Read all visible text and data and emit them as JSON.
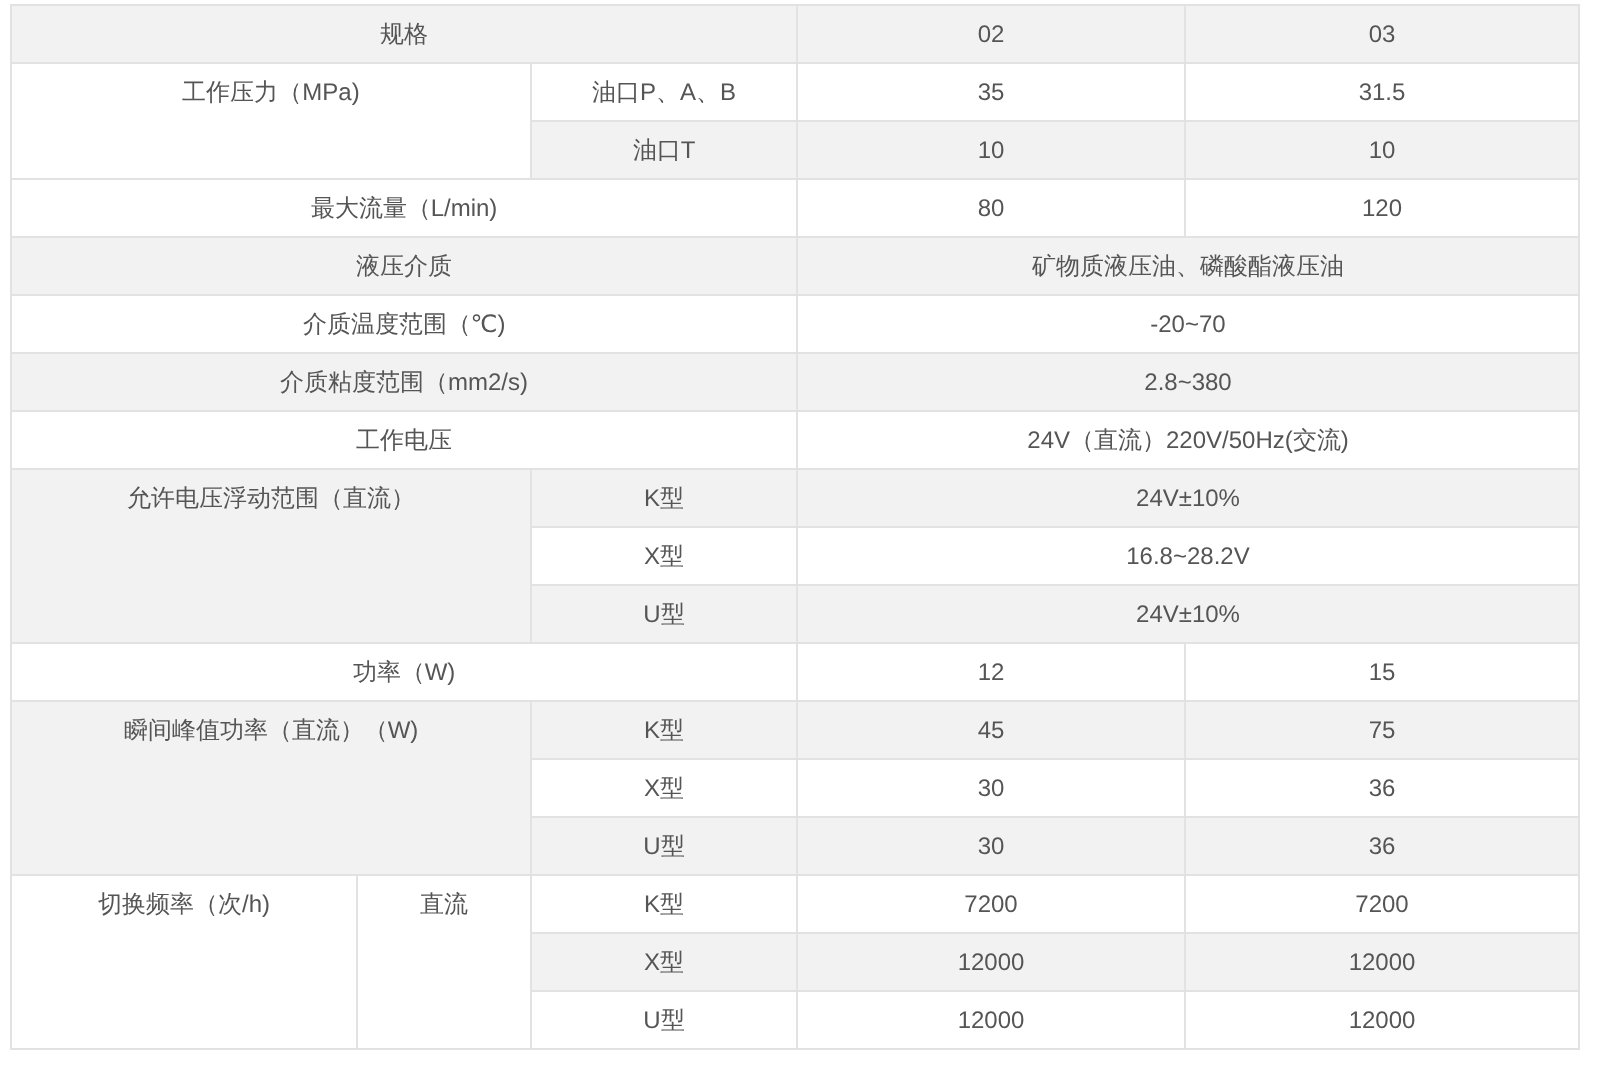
{
  "table": {
    "groups": [
      {
        "label": "规格",
        "values": [
          "02",
          "03"
        ]
      },
      {
        "label": "工作压力（MPa)",
        "subrows": [
          {
            "label": "油口P、A、B",
            "values": [
              "35",
              "31.5"
            ]
          },
          {
            "label": "油口T",
            "values": [
              "10",
              "10"
            ]
          }
        ]
      },
      {
        "label": "最大流量（L/min)",
        "values": [
          "80",
          "120"
        ]
      },
      {
        "label": "液压介质",
        "value": "矿物质液压油、磷酸酯液压油"
      },
      {
        "label": "介质温度范围（℃)",
        "value": "-20~70"
      },
      {
        "label": "介质粘度范围（mm2/s)",
        "value": "2.8~380"
      },
      {
        "label": "工作电压",
        "value": "24V（直流）220V/50Hz(交流)"
      },
      {
        "label": "允许电压浮动范围（直流）",
        "subrows": [
          {
            "label": "K型",
            "value": "24V±10%"
          },
          {
            "label": "X型",
            "value": "16.8~28.2V"
          },
          {
            "label": "U型",
            "value": "24V±10%"
          }
        ]
      },
      {
        "label": "功率（W)",
        "values": [
          "12",
          "15"
        ]
      },
      {
        "label": "瞬间峰值功率（直流）（W)",
        "subrows": [
          {
            "label": "K型",
            "values": [
              "45",
              "75"
            ]
          },
          {
            "label": "X型",
            "values": [
              "30",
              "36"
            ]
          },
          {
            "label": "U型",
            "values": [
              "30",
              "36"
            ]
          }
        ]
      },
      {
        "label": "切换频率（次/h)",
        "group": "直流",
        "subrows": [
          {
            "label": "K型",
            "values": [
              "7200",
              "7200"
            ]
          },
          {
            "label": "X型",
            "values": [
              "12000",
              "12000"
            ]
          },
          {
            "label": "U型",
            "values": [
              "12000",
              "12000"
            ]
          }
        ]
      }
    ]
  }
}
